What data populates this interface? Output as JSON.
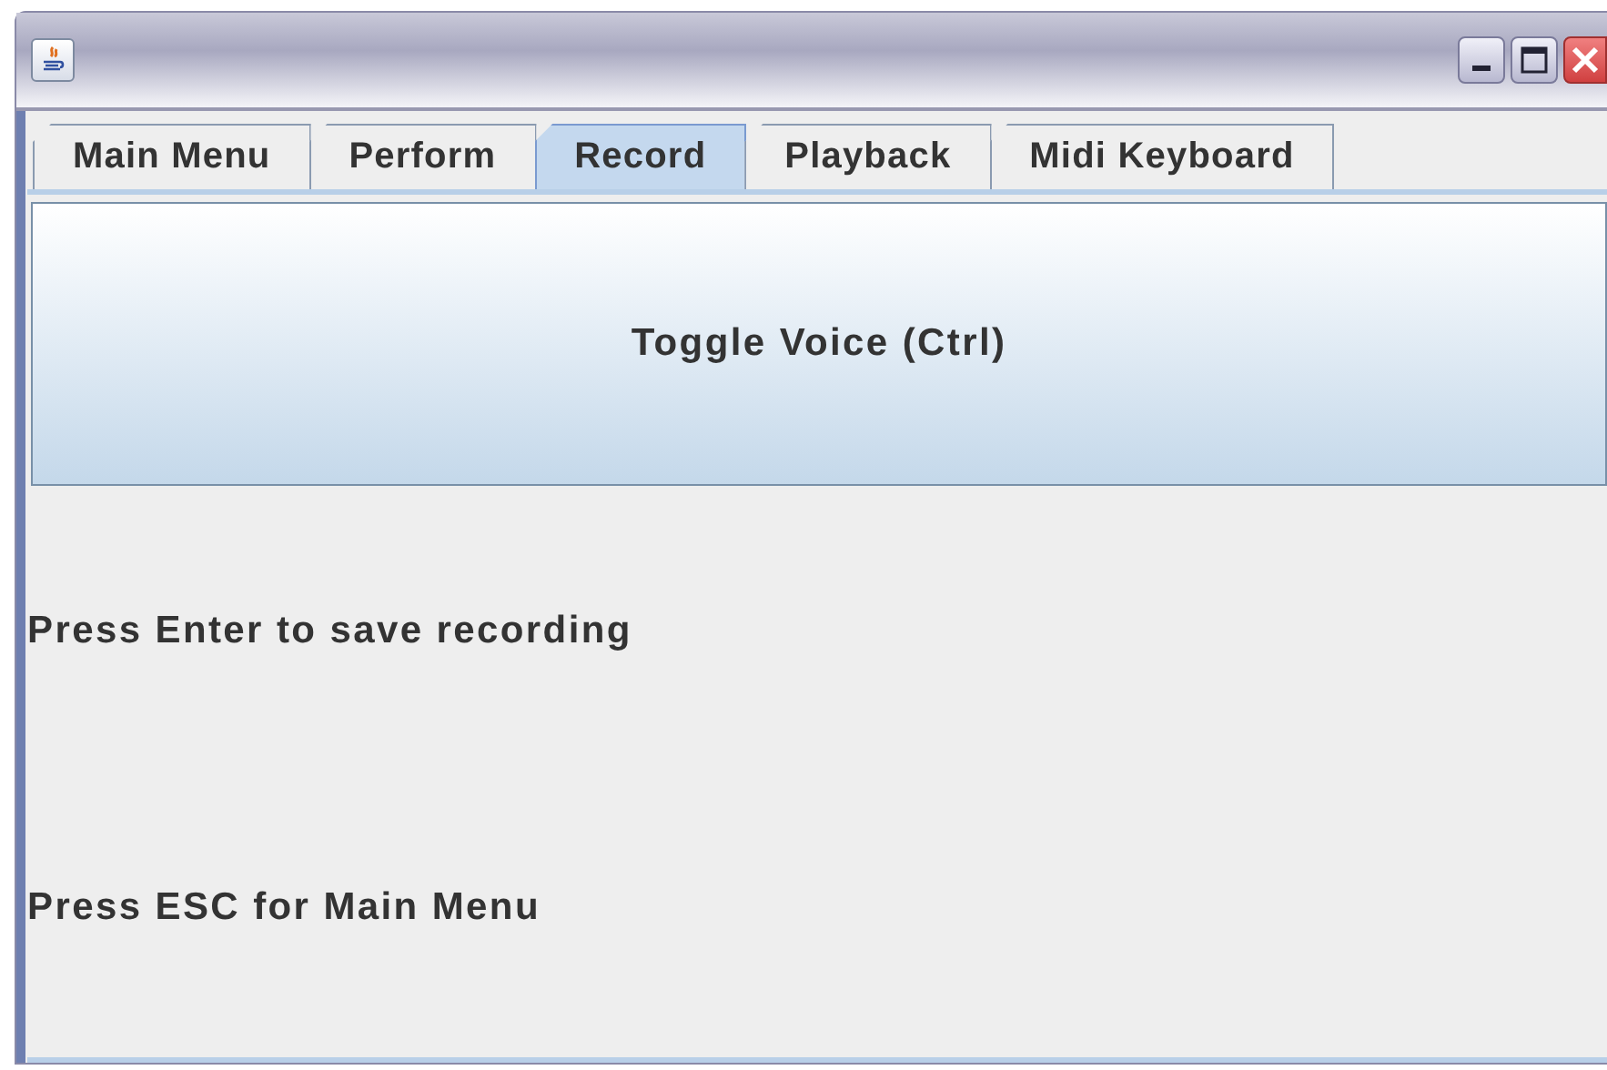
{
  "tabs": [
    {
      "label": "Main Menu",
      "selected": false
    },
    {
      "label": "Perform",
      "selected": false
    },
    {
      "label": "Record",
      "selected": true
    },
    {
      "label": "Playback",
      "selected": false
    },
    {
      "label": "Midi Keyboard",
      "selected": false
    }
  ],
  "toggle_button": {
    "label": "Toggle Voice (Ctrl)"
  },
  "instructions": [
    "Press Enter to save recording",
    "Press ESC for Main Menu"
  ]
}
